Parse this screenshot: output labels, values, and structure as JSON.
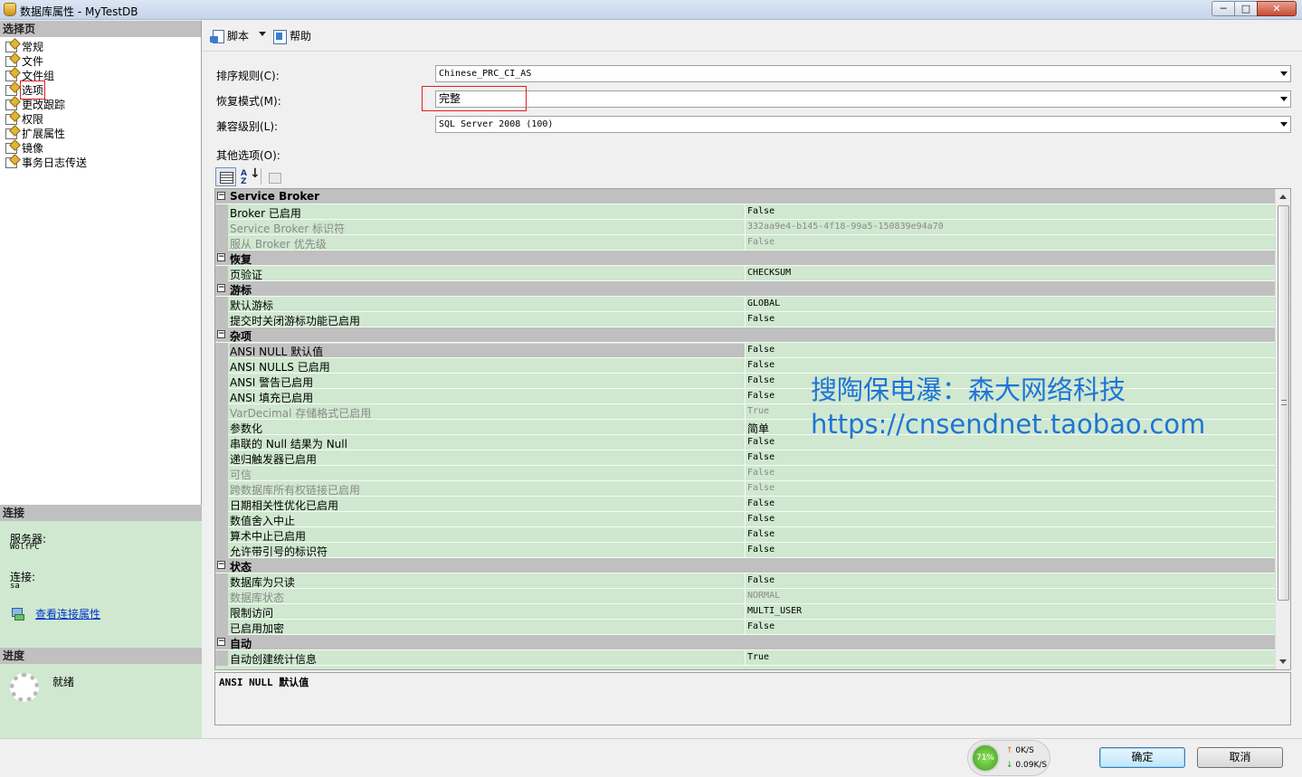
{
  "window": {
    "title": "数据库属性 - MyTestDB",
    "controls": {
      "minimize": "─",
      "maximize": "□",
      "close": "✕"
    }
  },
  "left": {
    "select_page_header": "选择页",
    "pages": [
      "常规",
      "文件",
      "文件组",
      "选项",
      "更改跟踪",
      "权限",
      "扩展属性",
      "镜像",
      "事务日志传送"
    ],
    "selected_page": "选项",
    "connection": {
      "header": "连接",
      "server_label": "服务器:",
      "server_value": "WolfPC",
      "connection_label": "连接:",
      "connection_value": "sa",
      "link": "查看连接属性"
    },
    "progress": {
      "header": "进度",
      "status": "就绪"
    }
  },
  "toolbar": {
    "script_label": "脚本",
    "help_label": "帮助"
  },
  "form": {
    "collation_label": "排序规则(C):",
    "collation_value": "Chinese_PRC_CI_AS",
    "recovery_label": "恢复模式(M):",
    "recovery_value": "完整",
    "compat_label": "兼容级别(L):",
    "compat_value": "SQL Server 2008 (100)",
    "other_options_label": "其他选项(O):"
  },
  "property_grid": {
    "categories": [
      {
        "name": "Service Broker",
        "rows": [
          {
            "name": "Broker 已启用",
            "value": "False",
            "disabled": false
          },
          {
            "name": "Service Broker 标识符",
            "value": "332aa9e4-b145-4f18-99a5-150839e94a70",
            "disabled": true
          },
          {
            "name": "服从 Broker 优先级",
            "value": "False",
            "disabled": true
          }
        ]
      },
      {
        "name": "恢复",
        "rows": [
          {
            "name": "页验证",
            "value": "CHECKSUM",
            "disabled": false
          }
        ]
      },
      {
        "name": "游标",
        "rows": [
          {
            "name": "默认游标",
            "value": "GLOBAL",
            "disabled": false
          },
          {
            "name": "提交时关闭游标功能已启用",
            "value": "False",
            "disabled": false
          }
        ]
      },
      {
        "name": "杂项",
        "rows": [
          {
            "name": "ANSI NULL 默认值",
            "value": "False",
            "disabled": false,
            "selected": true
          },
          {
            "name": "ANSI NULLS 已启用",
            "value": "False",
            "disabled": false
          },
          {
            "name": "ANSI 警告已启用",
            "value": "False",
            "disabled": false
          },
          {
            "name": "ANSI 填充已启用",
            "value": "False",
            "disabled": false
          },
          {
            "name": "VarDecimal 存储格式已启用",
            "value": "True",
            "disabled": true
          },
          {
            "name": "参数化",
            "value": "简单",
            "disabled": false
          },
          {
            "name": "串联的 Null 结果为 Null",
            "value": "False",
            "disabled": false
          },
          {
            "name": "递归触发器已启用",
            "value": "False",
            "disabled": false
          },
          {
            "name": "可信",
            "value": "False",
            "disabled": true
          },
          {
            "name": "跨数据库所有权链接已启用",
            "value": "False",
            "disabled": true
          },
          {
            "name": "日期相关性优化已启用",
            "value": "False",
            "disabled": false
          },
          {
            "name": "数值舍入中止",
            "value": "False",
            "disabled": false
          },
          {
            "name": "算术中止已启用",
            "value": "False",
            "disabled": false
          },
          {
            "name": "允许带引号的标识符",
            "value": "False",
            "disabled": false
          }
        ]
      },
      {
        "name": "状态",
        "rows": [
          {
            "name": "数据库为只读",
            "value": "False",
            "disabled": false
          },
          {
            "name": "数据库状态",
            "value": "NORMAL",
            "disabled": true
          },
          {
            "name": "限制访问",
            "value": "MULTI_USER",
            "disabled": false
          },
          {
            "name": "已启用加密",
            "value": "False",
            "disabled": false
          }
        ]
      },
      {
        "name": "自动",
        "rows": [
          {
            "name": "自动创建统计信息",
            "value": "True",
            "disabled": false
          }
        ]
      }
    ],
    "expander_symbol": "−",
    "description_title": "ANSI NULL 默认值"
  },
  "watermark": {
    "line1": "搜陶保电瀑：森大网络科技",
    "line2": "https://cnsendnet.taobao.com"
  },
  "net_widget": {
    "percent": "71%",
    "up_arrow": "↑",
    "up_speed": "0K/S",
    "down_arrow": "↓",
    "down_speed": "0.09K/S"
  },
  "buttons": {
    "ok": "确定",
    "cancel": "取消"
  }
}
